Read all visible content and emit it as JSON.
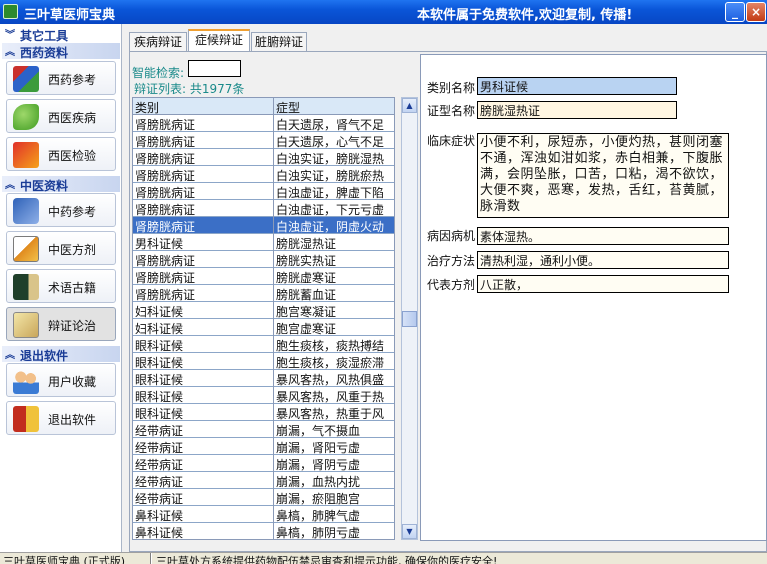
{
  "titlebar": {
    "app_title": "三叶草医师宝典",
    "notice": "本软件属于免费软件,欢迎复制, 传播!",
    "minimize_glyph": "_",
    "close_glyph": "×"
  },
  "sidebar": {
    "sections": [
      {
        "label": "其它工具"
      },
      {
        "label": "西药资料"
      },
      {
        "label": "中医资料"
      },
      {
        "label": "退出软件"
      }
    ],
    "items": [
      {
        "label": "西药参考",
        "icon": "books-icon"
      },
      {
        "label": "西医疾病",
        "icon": "pill-icon"
      },
      {
        "label": "西医检验",
        "icon": "medicine-box-icon"
      },
      {
        "label": "中药参考",
        "icon": "herb-icon"
      },
      {
        "label": "中医方剂",
        "icon": "prescription-icon"
      },
      {
        "label": "术语古籍",
        "icon": "ancient-book-icon"
      },
      {
        "label": "辩证论治",
        "icon": "diagnosis-icon"
      },
      {
        "label": "用户收藏",
        "icon": "users-icon"
      },
      {
        "label": "退出软件",
        "icon": "exit-icon"
      }
    ]
  },
  "tabs": [
    {
      "label": "疾病辩证"
    },
    {
      "label": "症候辩证"
    },
    {
      "label": "脏腑辩证"
    }
  ],
  "search": {
    "label": "智能检索:",
    "value": "",
    "count_text": "辩证列表: 共1977条"
  },
  "list": {
    "headers": [
      "类别",
      "症型"
    ],
    "selected_index": 6,
    "rows": [
      [
        "肾膀胱病证",
        "白天遗尿，肾气不足"
      ],
      [
        "肾膀胱病证",
        "白天遗尿，心气不足"
      ],
      [
        "肾膀胱病证",
        "白浊实证，膀胱湿热"
      ],
      [
        "肾膀胱病证",
        "白浊实证，膀胱瘀热"
      ],
      [
        "肾膀胱病证",
        "白浊虚证，脾虚下陷"
      ],
      [
        "肾膀胱病证",
        "白浊虚证，下元亏虚"
      ],
      [
        "肾膀胱病证",
        "白浊虚证，阴虚火动"
      ],
      [
        "男科证候",
        "膀胱湿热证"
      ],
      [
        "肾膀胱病证",
        "膀胱实热证"
      ],
      [
        "肾膀胱病证",
        "膀胱虚寒证"
      ],
      [
        "肾膀胱病证",
        "膀胱蓄血证"
      ],
      [
        "妇科证候",
        "胞宫寒凝证"
      ],
      [
        "妇科证候",
        "胞宫虚寒证"
      ],
      [
        "眼科证候",
        "胞生痰核，痰热搏结"
      ],
      [
        "眼科证候",
        "胞生痰核，痰湿瘀滞"
      ],
      [
        "眼科证候",
        "暴风客热，风热俱盛"
      ],
      [
        "眼科证候",
        "暴风客热，风重于热"
      ],
      [
        "眼科证候",
        "暴风客热，热重于风"
      ],
      [
        "经带病证",
        "崩漏，气不摄血"
      ],
      [
        "经带病证",
        "崩漏，肾阳亏虚"
      ],
      [
        "经带病证",
        "崩漏，肾阴亏虚"
      ],
      [
        "经带病证",
        "崩漏，血热内扰"
      ],
      [
        "经带病证",
        "崩漏，瘀阻胞宫"
      ],
      [
        "鼻科证候",
        "鼻槁，肺脾气虚"
      ],
      [
        "鼻科证候",
        "鼻槁，肺阴亏虚"
      ]
    ]
  },
  "detail": {
    "category_label": "类别名称",
    "category_value": "男科证候",
    "pattern_label": "证型名称",
    "pattern_value": "膀胱湿热证",
    "symptoms_label": "临床症状",
    "symptoms_value": "小便不利，尿短赤，小便灼热，甚则闭塞不通，浑浊如泔如浆，赤白相兼，下腹胀满，会阴坠胀，口苦，口粘，渴不欲饮，大便不爽，恶寒，发热，舌红，苔黄腻，脉滑数",
    "cause_label": "病因病机",
    "cause_value": "素体湿热。",
    "treatment_label": "治疗方法",
    "treatment_value": "清热利湿，通利小便。",
    "formula_label": "代表方剂",
    "formula_value": "八正散，"
  },
  "statusbar": {
    "left": "三叶草医师宝典 (正式版)",
    "right": "三叶草处方系统提供药物配伍禁忌审查和提示功能, 确保你的医疗安全!"
  },
  "colors": {
    "titlebar_blue": "#0a55d8",
    "selected_row": "#3b6fc6",
    "category_field": "#b9d3f2",
    "pattern_field": "#fff6e2",
    "section_text": "#1a3c96"
  }
}
